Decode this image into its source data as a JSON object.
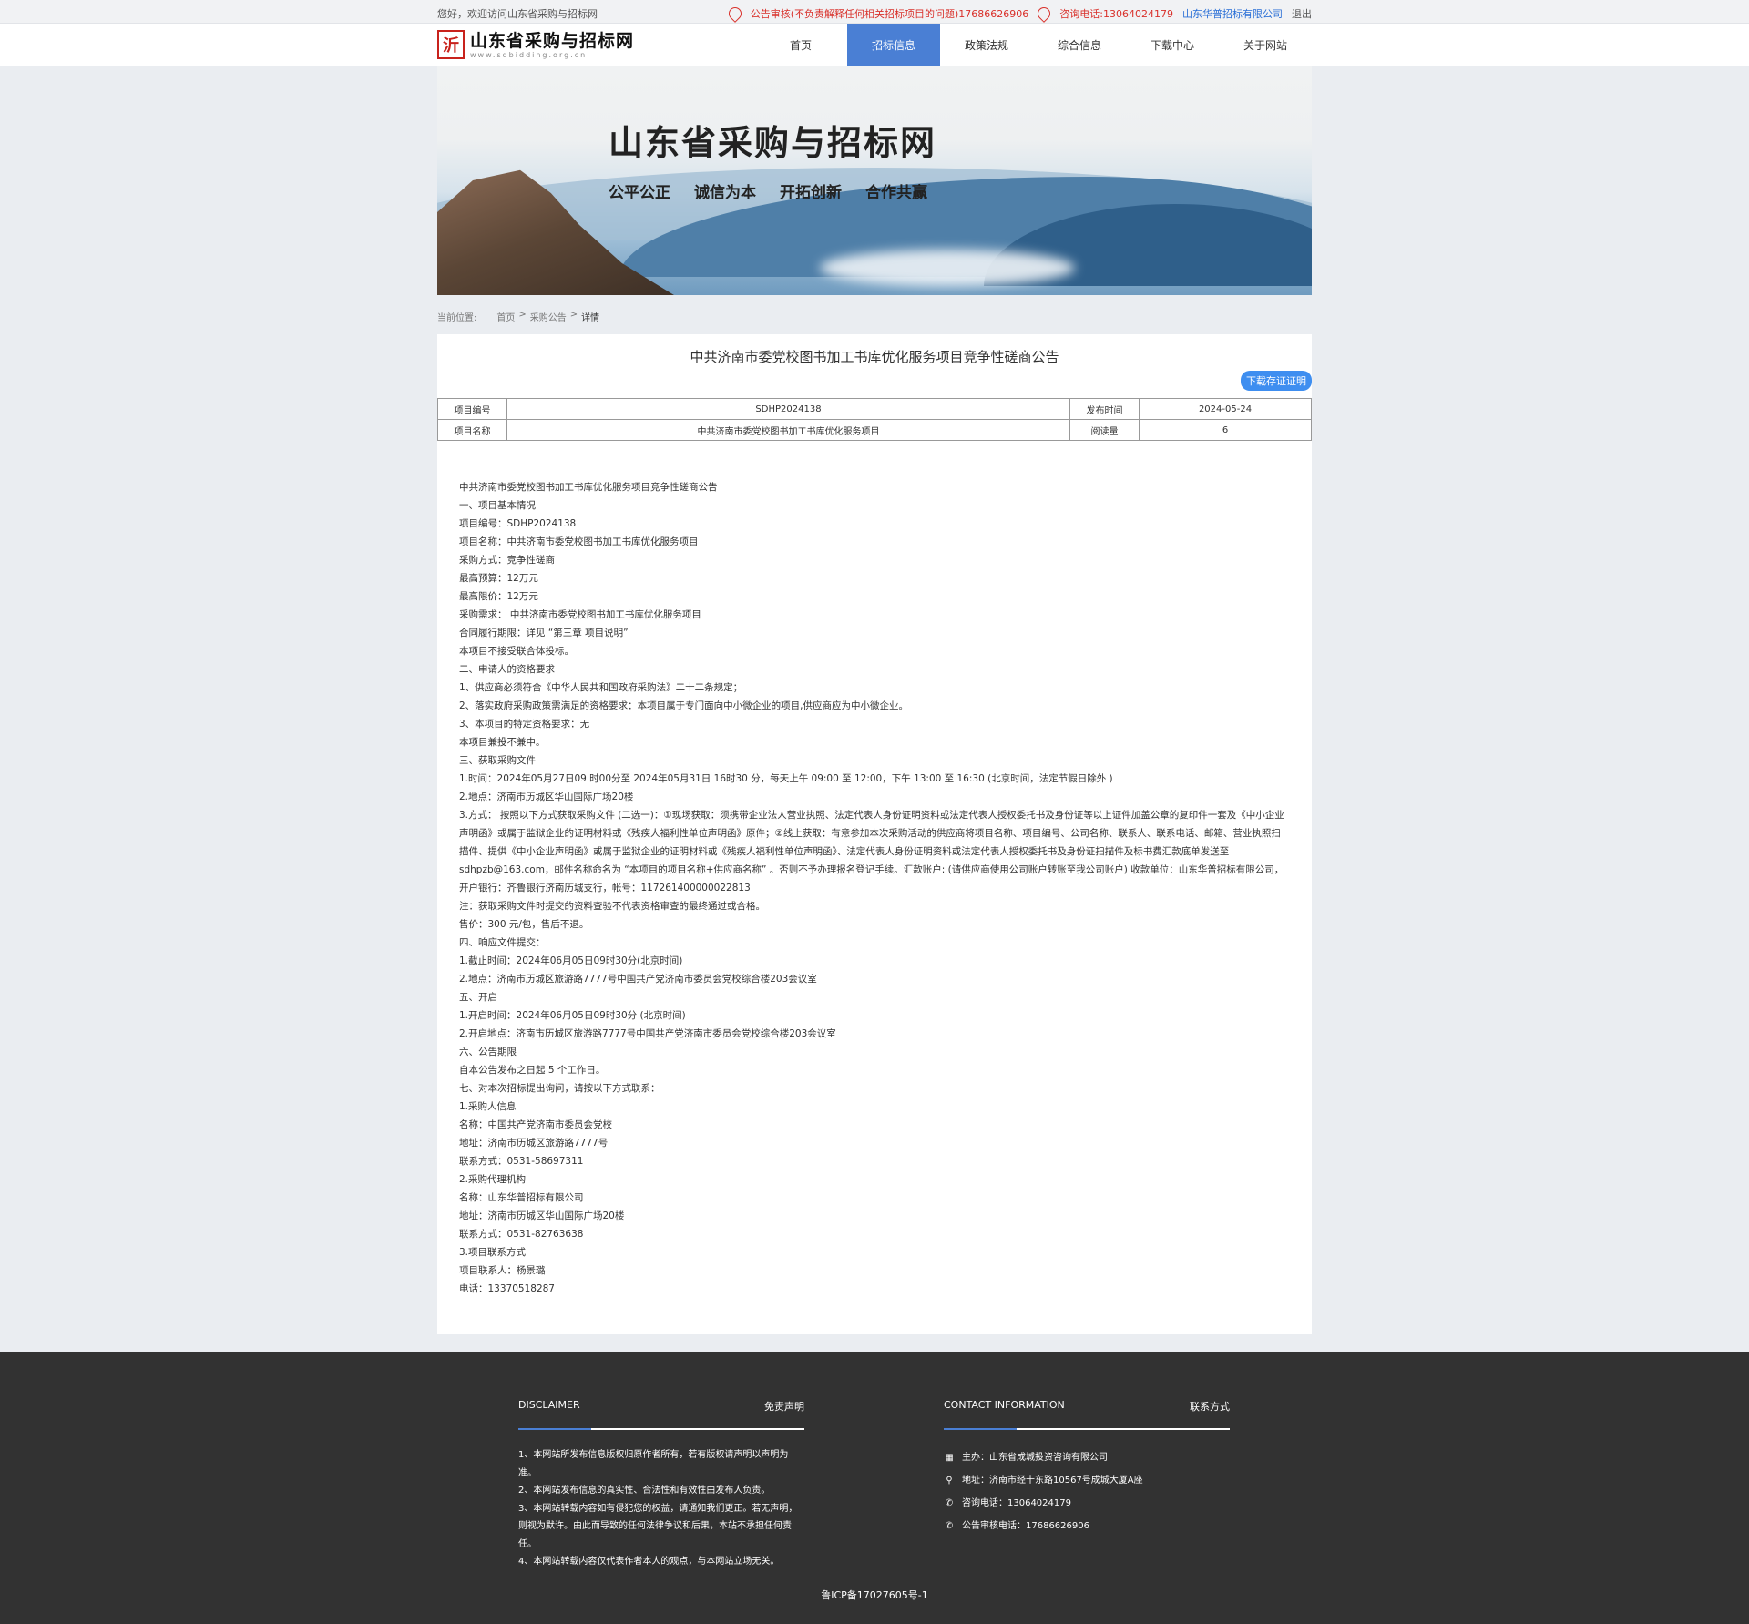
{
  "topbar": {
    "welcome": "您好，欢迎访问山东省采购与招标网",
    "notice": "公告审核(不负责解释任何相关招标项目的问题)17686626906",
    "consult": "咨询电话:13064024179",
    "company": "山东华普招标有限公司",
    "logout": "退出"
  },
  "header": {
    "logo_mark": "沂",
    "logo_cn": "山东省采购与招标网",
    "logo_en": "www.sdbidding.org.cn",
    "nav": [
      "首页",
      "招标信息",
      "政策法规",
      "综合信息",
      "下载中心",
      "关于网站"
    ]
  },
  "banner": {
    "title": "山东省采购与招标网",
    "slogans": [
      "公平公正",
      "诚信为本",
      "开拓创新",
      "合作共赢"
    ]
  },
  "breadcrumb": {
    "label": "当前位置:",
    "home": "首页",
    "sep1": ">",
    "section": "采购公告",
    "sep2": ">",
    "current": "详情"
  },
  "article": {
    "title": "中共济南市委党校图书加工书库优化服务项目竞争性磋商公告",
    "download": "下载存证证明",
    "table": {
      "row1": [
        "项目编号",
        "SDHP2024138",
        "发布时间",
        "2024-05-24"
      ],
      "row2": [
        "项目名称",
        "中共济南市委党校图书加工书库优化服务项目",
        "阅读量",
        "6"
      ]
    },
    "lines": [
      "中共济南市委党校图书加工书库优化服务项目竞争性磋商公告",
      "一、项目基本情况",
      "项目编号：SDHP2024138",
      "项目名称：中共济南市委党校图书加工书库优化服务项目",
      "采购方式：竞争性磋商",
      "最高预算：12万元",
      "最高限价：12万元",
      "采购需求： 中共济南市委党校图书加工书库优化服务项目",
      "合同履行期限：详见 “第三章 项目说明”",
      "本项目不接受联合体投标。",
      "二、申请人的资格要求",
      "1、供应商必须符合《中华人民共和国政府采购法》二十二条规定；",
      "2、落实政府采购政策需满足的资格要求：本项目属于专门面向中小微企业的项目,供应商应为中小微企业。",
      "3、本项目的特定资格要求：无",
      "本项目兼投不兼中。",
      "三、获取采购文件",
      "1.时间：2024年05月27日09 时00分至 2024年05月31日 16时30 分，每天上午 09:00 至 12:00，下午 13:00 至 16:30 (北京时间，法定节假日除外 )",
      "2.地点：济南市历城区华山国际广场20楼",
      "3.方式： 按照以下方式获取采购文件 (二选一)：①现场获取：须携带企业法人营业执照、法定代表人身份证明资料或法定代表人授权委托书及身份证等以上证件加盖公章的复印件一套及《中小企业声明函》或属于监狱企业的证明材料或《残疾人福利性单位声明函》原件；②线上获取：有意参加本次采购活动的供应商将项目名称、项目编号、公司名称、联系人、联系电话、邮箱、营业执照扫描件、提供《中小企业声明函》或属于监狱企业的证明材料或《残疾人福利性单位声明函》、法定代表人身份证明资料或法定代表人授权委托书及身份证扫描件及标书费汇款底单发送至sdhpzb@163.com，邮件名称命名为 “本项目的项目名称+供应商名称” 。否则不予办理报名登记手续。汇款账户: (请供应商使用公司账户转账至我公司账户) 收款单位：山东华普招标有限公司，开户银行：齐鲁银行济南历城支行，帐号：117261400000022813",
      "注：获取采购文件时提交的资料查验不代表资格审查的最终通过或合格。",
      "售价：300 元/包，售后不退。",
      "四、响应文件提交：",
      "1.截止时间：2024年06月05日09时30分(北京时间)",
      "2.地点：济南市历城区旅游路7777号中国共产党济南市委员会党校综合楼203会议室",
      "五、开启",
      "1.开启时间：2024年06月05日09时30分 (北京时间)",
      "2.开启地点：济南市历城区旅游路7777号中国共产党济南市委员会党校综合楼203会议室",
      "六、公告期限",
      "自本公告发布之日起 5 个工作日。",
      "七、对本次招标提出询问，请按以下方式联系：",
      "1.采购人信息",
      "名称：中国共产党济南市委员会党校",
      "地址：济南市历城区旅游路7777号",
      "联系方式：0531-58697311",
      "2.采购代理机构",
      "名称：山东华普招标有限公司",
      "地址：济南市历城区华山国际广场20楼",
      "联系方式：0531-82763638",
      "3.项目联系方式",
      "项目联系人：杨景璐",
      "电话：13370518287"
    ]
  },
  "footer": {
    "disclaimer_en": "DISCLAIMER",
    "disclaimer_cn": "免责声明",
    "disclaimer_items": [
      "1、本网站所发布信息版权归原作者所有，若有版权请声明以声明为准。",
      "2、本网站发布信息的真实性、合法性和有效性由发布人负责。",
      "3、本网站转载内容如有侵犯您的权益，请通知我们更正。若无声明，则视为默许。由此而导致的任何法律争议和后果，本站不承担任何责任。",
      "4、本网站转载内容仅代表作者本人的观点，与本网站立场无关。"
    ],
    "contact_en": "CONTACT INFORMATION",
    "contact_cn": "联系方式",
    "contact_items": [
      {
        "icon": "building-icon",
        "text": "主办：山东省成城投资咨询有限公司"
      },
      {
        "icon": "location-icon",
        "text": "地址：济南市经十东路10567号成城大厦A座"
      },
      {
        "icon": "phone-icon",
        "text": "咨询电话：13064024179"
      },
      {
        "icon": "phone-icon",
        "text": "公告审核电话：17686626906"
      }
    ],
    "icp": "鲁ICP备17027605号-1"
  }
}
